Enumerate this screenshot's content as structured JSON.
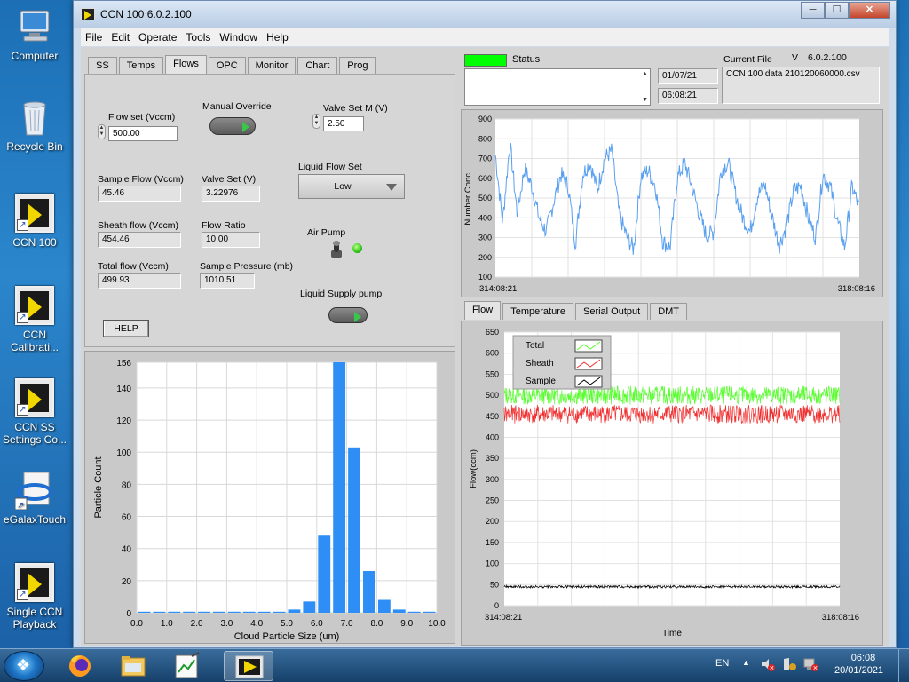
{
  "desktop": {
    "icons": [
      {
        "label": "Computer"
      },
      {
        "label": "Recycle Bin"
      },
      {
        "label": "CCN 100"
      },
      {
        "label": "CCN Calibrati..."
      },
      {
        "label": "CCN SS Settings Co..."
      },
      {
        "label": "eGalaxTouch"
      },
      {
        "label": "Single CCN Playback"
      }
    ]
  },
  "window": {
    "title": "CCN 100 6.0.2.100",
    "controls": {
      "minimize": "─",
      "maximize": "☐",
      "close": "✕"
    }
  },
  "menu": [
    "File",
    "Edit",
    "Operate",
    "Tools",
    "Window",
    "Help"
  ],
  "left_tabs": [
    "SS",
    "Temps",
    "Flows",
    "OPC",
    "Monitor",
    "Chart",
    "Prog"
  ],
  "flows": {
    "flow_set_label": "Flow set (Vccm)",
    "flow_set_value": "500.00",
    "manual_override_label": "Manual Override",
    "valve_set_m_label": "Valve Set M (V)",
    "valve_set_m_value": "2.50",
    "sample_flow_label": "Sample Flow (Vccm)",
    "sample_flow_value": "45.46",
    "valve_set_label": "Valve Set (V)",
    "valve_set_value": "3.22976",
    "liquid_flow_set_label": "Liquid Flow Set",
    "liquid_flow_set_value": "Low",
    "sheath_flow_label": "Sheath flow (Vccm)",
    "sheath_flow_value": "454.46",
    "flow_ratio_label": "Flow Ratio",
    "flow_ratio_value": "10.00",
    "air_pump_label": "Air Pump",
    "total_flow_label": "Total flow (Vccm)",
    "total_flow_value": "499.93",
    "sample_pressure_label": "Sample  Pressure (mb)",
    "sample_pressure_value": "1010.51",
    "liquid_supply_label": "Liquid Supply pump",
    "help_label": "HELP"
  },
  "status": {
    "label": "Status",
    "led_color": "#00ff00",
    "date": "01/07/21",
    "time": "06:08:21",
    "current_file_label": "Current File",
    "version_prefix": "V",
    "version": "6.0.2.100",
    "current_file": "CCN 100 data 210120060000.csv"
  },
  "right_tabs": [
    "Flow",
    "Temperature",
    "Serial Output",
    "DMT"
  ],
  "chart_data": [
    {
      "type": "bar",
      "xlabel": "Cloud Particle Size (um)",
      "ylabel": "Particle Count",
      "xlim": [
        0,
        10
      ],
      "ylim": [
        0,
        156
      ],
      "xticks": [
        "0.0",
        "1.0",
        "2.0",
        "3.0",
        "4.0",
        "5.0",
        "6.0",
        "7.0",
        "8.0",
        "9.0",
        "10.0"
      ],
      "yticks": [
        "0",
        "20",
        "40",
        "60",
        "80",
        "100",
        "120",
        "140",
        "156"
      ],
      "bin_starts": [
        0.25,
        0.75,
        1.25,
        1.75,
        2.25,
        2.75,
        3.25,
        3.75,
        4.25,
        4.75,
        5.25,
        5.75,
        6.25,
        6.75,
        7.25,
        7.75,
        8.25,
        8.75,
        9.25,
        9.75
      ],
      "values": [
        0,
        0,
        0,
        0,
        0,
        0,
        0,
        0,
        0,
        0,
        2,
        7,
        48,
        156,
        103,
        26,
        8,
        2,
        0,
        0
      ],
      "color": "#2f8ef5"
    },
    {
      "type": "line",
      "ylabel": "Number Conc.",
      "xlim_labels": [
        "314:08:21",
        "318:08:16"
      ],
      "ylim": [
        100,
        900
      ],
      "yticks": [
        "100",
        "200",
        "300",
        "400",
        "500",
        "600",
        "700",
        "800",
        "900"
      ],
      "color": "#5aa0f0",
      "series_points": [
        [
          0,
          720
        ],
        [
          0.02,
          380
        ],
        [
          0.04,
          780
        ],
        [
          0.06,
          420
        ],
        [
          0.08,
          650
        ],
        [
          0.1,
          560
        ],
        [
          0.12,
          400
        ],
        [
          0.14,
          330
        ],
        [
          0.16,
          480
        ],
        [
          0.18,
          620
        ],
        [
          0.2,
          560
        ],
        [
          0.22,
          270
        ],
        [
          0.24,
          620
        ],
        [
          0.26,
          680
        ],
        [
          0.28,
          540
        ],
        [
          0.3,
          700
        ],
        [
          0.32,
          740
        ],
        [
          0.34,
          420
        ],
        [
          0.36,
          310
        ],
        [
          0.38,
          240
        ],
        [
          0.4,
          610
        ],
        [
          0.42,
          640
        ],
        [
          0.44,
          560
        ],
        [
          0.46,
          280
        ],
        [
          0.48,
          250
        ],
        [
          0.5,
          600
        ],
        [
          0.52,
          680
        ],
        [
          0.54,
          560
        ],
        [
          0.56,
          420
        ],
        [
          0.58,
          310
        ],
        [
          0.6,
          330
        ],
        [
          0.62,
          640
        ],
        [
          0.64,
          680
        ],
        [
          0.66,
          520
        ],
        [
          0.68,
          400
        ],
        [
          0.7,
          330
        ],
        [
          0.72,
          510
        ],
        [
          0.74,
          570
        ],
        [
          0.76,
          410
        ],
        [
          0.78,
          260
        ],
        [
          0.8,
          360
        ],
        [
          0.82,
          540
        ],
        [
          0.84,
          560
        ],
        [
          0.86,
          400
        ],
        [
          0.88,
          300
        ],
        [
          0.9,
          620
        ],
        [
          0.92,
          560
        ],
        [
          0.94,
          380
        ],
        [
          0.96,
          250
        ],
        [
          0.98,
          560
        ],
        [
          1.0,
          450
        ]
      ]
    },
    {
      "type": "line",
      "ylabel": "Flow(ccm)",
      "xlabel": "Time",
      "xlim_labels": [
        "314:08:21",
        "318:08:16"
      ],
      "ylim": [
        0,
        650
      ],
      "yticks": [
        "0",
        "50",
        "100",
        "150",
        "200",
        "250",
        "300",
        "350",
        "400",
        "450",
        "500",
        "550",
        "600",
        "650"
      ],
      "series": [
        {
          "name": "Total",
          "color": "#55ff2a",
          "level": 500,
          "noise": 22
        },
        {
          "name": "Sheath",
          "color": "#f03030",
          "level": 455,
          "noise": 22
        },
        {
          "name": "Sample",
          "color": "#000000",
          "level": 45,
          "noise": 3
        }
      ]
    }
  ],
  "taskbar": {
    "lang": "EN",
    "time": "06:08",
    "date": "20/01/2021"
  }
}
